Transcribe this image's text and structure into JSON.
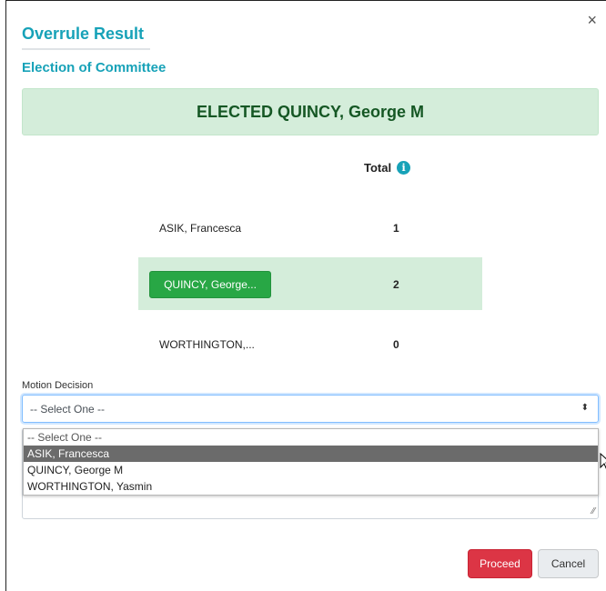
{
  "modal": {
    "close_glyph": "×",
    "title": "Overrule Result",
    "subtitle": "Election of Committee"
  },
  "result": {
    "elected_text": "ELECTED QUINCY, George M"
  },
  "table": {
    "total_header": "Total",
    "info_glyph": "i",
    "candidates": [
      {
        "name": "ASIK, Francesca",
        "total": "1"
      },
      {
        "name": "QUINCY, George...",
        "total": "2"
      },
      {
        "name": "WORTHINGTON,...",
        "total": "0"
      }
    ]
  },
  "motion": {
    "label": "Motion Decision",
    "selected": "-- Select One --",
    "arrow_glyph": "⬍",
    "options": [
      "-- Select One --",
      "ASIK, Francesca",
      "QUINCY, George M",
      "WORTHINGTON, Yasmin"
    ],
    "resize_glyph": "⁄⁄"
  },
  "actions": {
    "proceed_label": "Proceed",
    "cancel_label": "Cancel"
  },
  "colors": {
    "accent": "#17a2b8",
    "success_bg": "#d4edda",
    "success_text": "#155724",
    "winner_button": "#28a745",
    "danger": "#dc3545",
    "option_hover": "#6b6b6b"
  }
}
